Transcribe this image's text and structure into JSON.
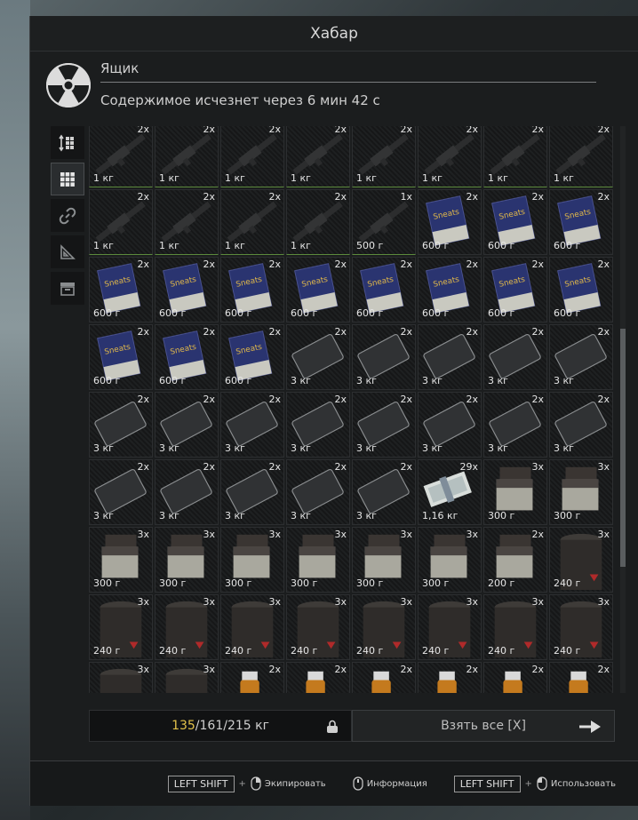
{
  "window": {
    "title": "Хабар"
  },
  "container": {
    "name": "Ящик",
    "subtitle": "Содержимое исчезнет через 6 мин 42 с"
  },
  "side_tools": [
    {
      "icon": "sort-icon"
    },
    {
      "icon": "grid-view-icon",
      "active": true
    },
    {
      "icon": "link-icon"
    },
    {
      "icon": "ruler-icon"
    },
    {
      "icon": "archive-icon"
    }
  ],
  "items": [
    {
      "type": "rifle",
      "count": "2x",
      "weight": "1 кг"
    },
    {
      "type": "rifle",
      "count": "2x",
      "weight": "1 кг"
    },
    {
      "type": "rifle",
      "count": "2x",
      "weight": "1 кг"
    },
    {
      "type": "rifle",
      "count": "2x",
      "weight": "1 кг"
    },
    {
      "type": "rifle",
      "count": "2x",
      "weight": "1 кг"
    },
    {
      "type": "rifle",
      "count": "2x",
      "weight": "1 кг"
    },
    {
      "type": "rifle",
      "count": "2x",
      "weight": "1 кг"
    },
    {
      "type": "rifle",
      "count": "2x",
      "weight": "1 кг"
    },
    {
      "type": "rifle",
      "count": "2x",
      "weight": "1 кг"
    },
    {
      "type": "rifle",
      "count": "2x",
      "weight": "1 кг"
    },
    {
      "type": "rifle",
      "count": "2x",
      "weight": "1 кг"
    },
    {
      "type": "rifle",
      "count": "2x",
      "weight": "1 кг"
    },
    {
      "type": "rifle",
      "count": "1x",
      "weight": "500 г"
    },
    {
      "type": "box",
      "count": "2x",
      "weight": "600 г"
    },
    {
      "type": "box",
      "count": "2x",
      "weight": "600 г"
    },
    {
      "type": "box",
      "count": "2x",
      "weight": "600 г"
    },
    {
      "type": "box",
      "count": "2x",
      "weight": "600 г"
    },
    {
      "type": "box",
      "count": "2x",
      "weight": "600 г"
    },
    {
      "type": "box",
      "count": "2x",
      "weight": "600 г"
    },
    {
      "type": "box",
      "count": "2x",
      "weight": "600 г"
    },
    {
      "type": "box",
      "count": "2x",
      "weight": "600 г"
    },
    {
      "type": "box",
      "count": "2x",
      "weight": "600 г"
    },
    {
      "type": "box",
      "count": "2x",
      "weight": "600 г"
    },
    {
      "type": "box",
      "count": "2x",
      "weight": "600 г"
    },
    {
      "type": "box",
      "count": "2x",
      "weight": "600 г"
    },
    {
      "type": "box",
      "count": "2x",
      "weight": "600 г"
    },
    {
      "type": "box",
      "count": "2x",
      "weight": "600 г"
    },
    {
      "type": "plate",
      "count": "2x",
      "weight": "3 кг"
    },
    {
      "type": "plate",
      "count": "2x",
      "weight": "3 кг"
    },
    {
      "type": "plate",
      "count": "2x",
      "weight": "3 кг"
    },
    {
      "type": "plate",
      "count": "2x",
      "weight": "3 кг"
    },
    {
      "type": "plate",
      "count": "2x",
      "weight": "3 кг"
    },
    {
      "type": "plate",
      "count": "2x",
      "weight": "3 кг"
    },
    {
      "type": "plate",
      "count": "2x",
      "weight": "3 кг"
    },
    {
      "type": "plate",
      "count": "2x",
      "weight": "3 кг"
    },
    {
      "type": "plate",
      "count": "2x",
      "weight": "3 кг"
    },
    {
      "type": "plate",
      "count": "2x",
      "weight": "3 кг"
    },
    {
      "type": "plate",
      "count": "2x",
      "weight": "3 кг"
    },
    {
      "type": "plate",
      "count": "2x",
      "weight": "3 кг"
    },
    {
      "type": "plate",
      "count": "2x",
      "weight": "3 кг"
    },
    {
      "type": "plate",
      "count": "2x",
      "weight": "3 кг"
    },
    {
      "type": "plate",
      "count": "2x",
      "weight": "3 кг"
    },
    {
      "type": "plate",
      "count": "2x",
      "weight": "3 кг"
    },
    {
      "type": "plate",
      "count": "2x",
      "weight": "3 кг"
    },
    {
      "type": "plate",
      "count": "2x",
      "weight": "3 кг"
    },
    {
      "type": "money",
      "count": "29x",
      "weight": "1,16 кг"
    },
    {
      "type": "pouch",
      "count": "3x",
      "weight": "300 г"
    },
    {
      "type": "pouch",
      "count": "3x",
      "weight": "300 г"
    },
    {
      "type": "pouch",
      "count": "3x",
      "weight": "300 г"
    },
    {
      "type": "pouch",
      "count": "3x",
      "weight": "300 г"
    },
    {
      "type": "pouch",
      "count": "3x",
      "weight": "300 г"
    },
    {
      "type": "pouch",
      "count": "3x",
      "weight": "300 г"
    },
    {
      "type": "pouch",
      "count": "3x",
      "weight": "300 г"
    },
    {
      "type": "pouch",
      "count": "3x",
      "weight": "300 г"
    },
    {
      "type": "pouch",
      "count": "2x",
      "weight": "200 г"
    },
    {
      "type": "can",
      "count": "3x",
      "weight": "240 г"
    },
    {
      "type": "can",
      "count": "3x",
      "weight": "240 г"
    },
    {
      "type": "can",
      "count": "3x",
      "weight": "240 г"
    },
    {
      "type": "can",
      "count": "3x",
      "weight": "240 г"
    },
    {
      "type": "can",
      "count": "3x",
      "weight": "240 г"
    },
    {
      "type": "can",
      "count": "3x",
      "weight": "240 г"
    },
    {
      "type": "can",
      "count": "3x",
      "weight": "240 г"
    },
    {
      "type": "can",
      "count": "3x",
      "weight": "240 г"
    },
    {
      "type": "can",
      "count": "3x",
      "weight": "240 г"
    },
    {
      "type": "can",
      "count": "3x",
      "weight": ""
    },
    {
      "type": "can",
      "count": "3x",
      "weight": ""
    },
    {
      "type": "lighter",
      "count": "2x",
      "weight": ""
    },
    {
      "type": "lighter",
      "count": "2x",
      "weight": ""
    },
    {
      "type": "lighter",
      "count": "2x",
      "weight": ""
    },
    {
      "type": "lighter",
      "count": "2x",
      "weight": ""
    },
    {
      "type": "lighter",
      "count": "2x",
      "weight": ""
    },
    {
      "type": "lighter",
      "count": "2x",
      "weight": ""
    }
  ],
  "weight": {
    "current": "135",
    "rest": "/161/215 кг"
  },
  "take_all_label": "Взять все [X]",
  "hints": {
    "key1": "LEFT SHIFT",
    "plus1": "+",
    "equip": "Экипировать",
    "info": "Информация",
    "key2": "LEFT SHIFT",
    "plus2": "+",
    "use": "Использовать"
  },
  "colors": {
    "accent_weight": "#e2c14a",
    "panel": "#1b1d1e",
    "green_edge": "#5c8a3c"
  }
}
